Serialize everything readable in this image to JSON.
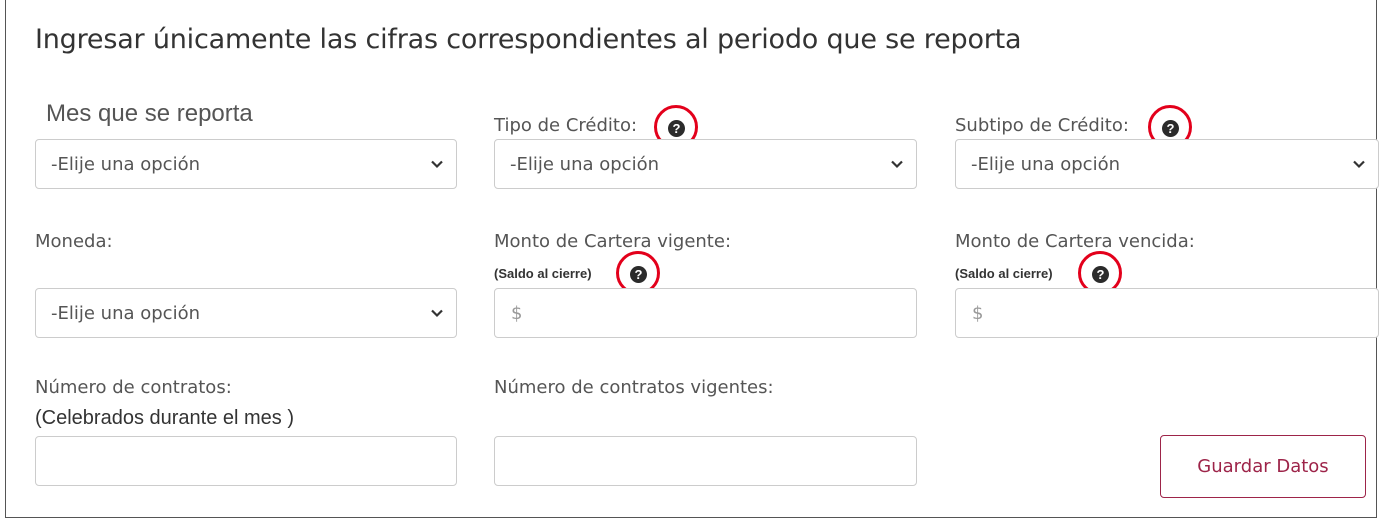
{
  "heading": "Ingresar únicamente las cifras correspondientes al periodo que se reporta",
  "fields": {
    "mes": {
      "label": "Mes que se reporta",
      "value": "-Elije una opción"
    },
    "tipo": {
      "label": "Tipo de Crédito:",
      "value": "-Elije una opción"
    },
    "subtipo": {
      "label": "Subtipo de Crédito:",
      "value": "-Elije una opción"
    },
    "moneda": {
      "label": "Moneda:",
      "value": "-Elije una opción"
    },
    "vigente": {
      "label": "Monto de Cartera vigente:",
      "sublabel": "(Saldo al cierre)",
      "placeholder": "$"
    },
    "vencida": {
      "label": "Monto de Cartera vencida:",
      "sublabel": "(Saldo al cierre)",
      "placeholder": "$"
    },
    "contratos": {
      "label": "Número de contratos:",
      "sublabel": "(Celebrados durante el mes )",
      "value": ""
    },
    "contratos_vigentes": {
      "label": "Número de contratos vigentes:",
      "value": ""
    }
  },
  "help_icon_glyph": "?",
  "save_button": "Guardar Datos",
  "colors": {
    "accent": "#9d2449",
    "highlight_ring": "#e3001b",
    "border": "#cccccc",
    "text": "#555555"
  }
}
